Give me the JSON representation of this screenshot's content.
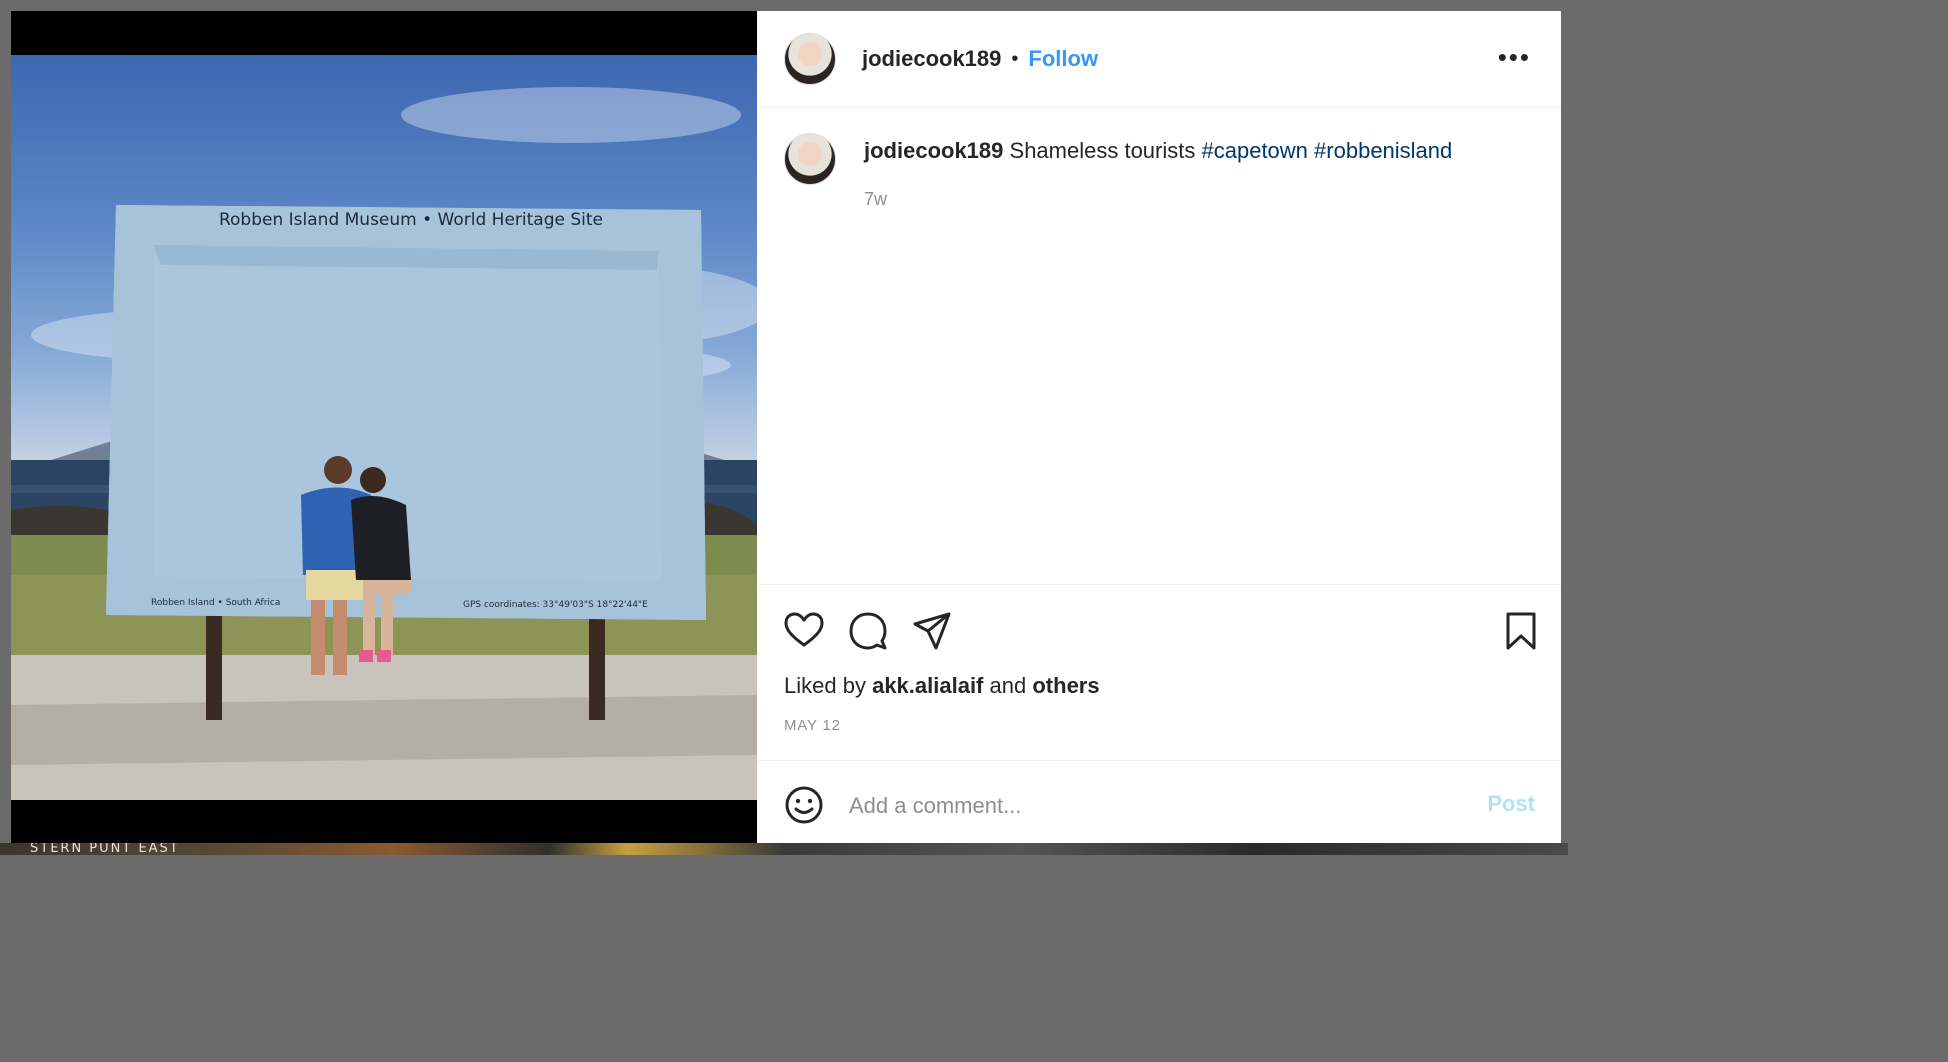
{
  "backdrop": {
    "partial_text": "STERN PUNT  EAST"
  },
  "post": {
    "image": {
      "sign_title": "Robben Island Museum • World Heritage Site",
      "sign_bottom_left": "Robben Island • South Africa",
      "sign_bottom_right": "GPS coordinates: 33°49'03\"S 18°22'44\"E"
    },
    "header": {
      "username": "jodiecook189",
      "separator": "•",
      "follow_label": "Follow",
      "more_icon": "more-horizontal-icon"
    },
    "caption": {
      "username": "jodiecook189",
      "text": "Shameless tourists",
      "hashtags": [
        "#capetown",
        "#robbenisland"
      ],
      "time": "7w"
    },
    "actions": {
      "icons": [
        "heart-icon",
        "comment-icon",
        "share-icon",
        "bookmark-icon"
      ]
    },
    "likes": {
      "prefix": "Liked by",
      "user": "akk.alialaif",
      "middle": "and",
      "others": "others"
    },
    "date": "MAY 12",
    "comment": {
      "placeholder": "Add a comment...",
      "post_label": "Post",
      "emoji_icon": "emoji-icon"
    },
    "colors": {
      "link": "#3897f0",
      "hashtag": "#00376b",
      "muted": "#8e8e8e",
      "post_disabled": "#b2dffc"
    }
  }
}
